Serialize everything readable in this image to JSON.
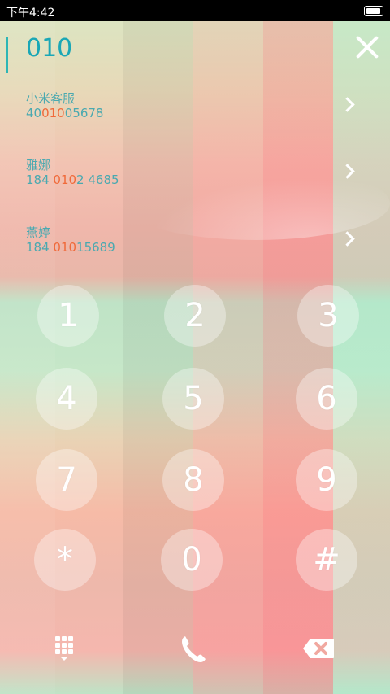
{
  "statusbar": {
    "time": "下午4:42"
  },
  "dialer": {
    "number": "010"
  },
  "contacts": [
    {
      "name": "小米客服",
      "num_prefix": "40",
      "num_highlight": "010",
      "num_suffix": "05678"
    },
    {
      "name": "雅娜",
      "num_prefix": "184 ",
      "num_highlight": "010",
      "num_suffix": "2 4685"
    },
    {
      "name": "燕婷",
      "num_prefix": "184 ",
      "num_highlight": "010",
      "num_suffix": "15689"
    }
  ],
  "keypad": {
    "k1": "1",
    "k2": "2",
    "k3": "3",
    "k4": "4",
    "k5": "5",
    "k6": "6",
    "k7": "7",
    "k8": "8",
    "k9": "9",
    "kstar": "*",
    "k0": "0",
    "khash": "#"
  },
  "icons": {
    "clear": "close-icon",
    "chevron": "chevron-right-icon",
    "dialpad": "dialpad-icon",
    "call": "phone-icon",
    "backspace": "backspace-icon"
  },
  "colors": {
    "accent": "#1aa7b6",
    "highlight": "#f06a3a"
  }
}
